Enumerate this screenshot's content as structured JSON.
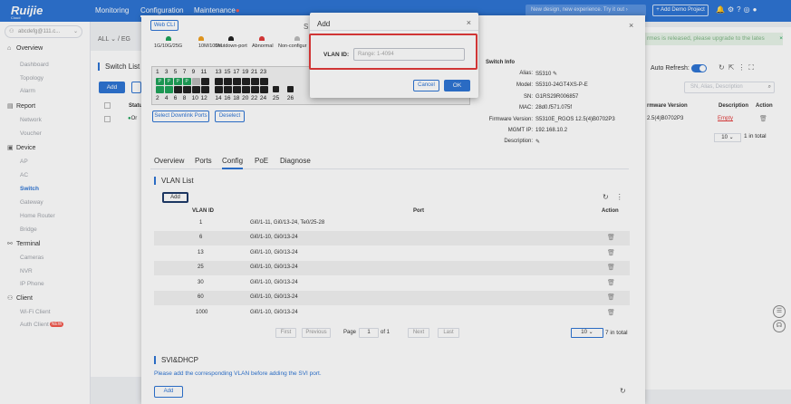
{
  "topbar": {
    "logo": "Ruijie",
    "logo_sub": "Cloud",
    "nav": [
      "Monitoring",
      "Configuration",
      "Maintenance"
    ],
    "new_design": "New design, new experience. Try it out",
    "demo_button": "+ Add Demo Project"
  },
  "sidebar": {
    "account": "abcdefg@111.c...",
    "items": [
      {
        "label": "Overview",
        "icon": "home-icon",
        "subs": [
          "Dashboard",
          "Topology",
          "Alarm"
        ]
      },
      {
        "label": "Report",
        "icon": "report-icon",
        "subs": [
          "Network",
          "Voucher"
        ]
      },
      {
        "label": "Device",
        "icon": "device-icon",
        "subs": [
          "AP",
          "AC",
          "Switch",
          "Gateway",
          "Home Router",
          "Bridge"
        ]
      },
      {
        "label": "Terminal",
        "icon": "terminal-icon",
        "subs": [
          "Cameras",
          "NVR",
          "IP Phone"
        ]
      },
      {
        "label": "Client",
        "icon": "client-icon",
        "subs": [
          "Wi-Fi Client",
          "Auth Client"
        ]
      }
    ],
    "active_sub": "Switch",
    "new_badge": "NEW"
  },
  "background": {
    "breadcrumb": "ALL",
    "breadcrumb_sep": "/",
    "breadcrumb_next": "EG",
    "switch_list": "Switch List",
    "add": "Add",
    "status": "Status",
    "online": "Or",
    "firmware_notice": "rmes is released, please upgrade to the lates",
    "auto_refresh": "Auto Refresh:",
    "search_placeholder": "SN, Alias, Description",
    "columns": [
      "rmware Version",
      "Description",
      "Action"
    ],
    "row": {
      "firmware": "2.5(4)B0702P3",
      "description": "Empty"
    },
    "page_size": "10",
    "total": "1 in total"
  },
  "drawer": {
    "webcli": "Web CLI",
    "title_partial": "S",
    "legend": [
      {
        "label": "1G/10G/25G",
        "color": "#1fa35a"
      },
      {
        "label": "10M/100M",
        "color": "#f0a020"
      },
      {
        "label": "Shutdown-port",
        "color": "#222222"
      },
      {
        "label": "Abnormal",
        "color": "#e23a3a"
      },
      {
        "label": "Non-configur",
        "color": "#bbbbbb"
      }
    ],
    "top_ports": [
      "1",
      "3",
      "5",
      "7",
      "9",
      "11",
      "13",
      "15",
      "17",
      "19",
      "21",
      "23"
    ],
    "bottom_ports": [
      "2",
      "4",
      "6",
      "8",
      "10",
      "12",
      "14",
      "16",
      "18",
      "20",
      "22",
      "24",
      "25",
      "26"
    ],
    "select_downlink": "Select Downlink Ports",
    "deselect": "Deselect",
    "switch_info": {
      "title": "Switch Info",
      "fields": [
        {
          "label": "Alias:",
          "value": "S5310"
        },
        {
          "label": "Model:",
          "value": "S5310-24GT4XS-P-E"
        },
        {
          "label": "SN:",
          "value": "G1RS29R006857"
        },
        {
          "label": "MAC:",
          "value": "28d0.f571.075f"
        },
        {
          "label": "Firmware Version:",
          "value": "S5310E_RGOS 12.5(4)B0702P3"
        },
        {
          "label": "MGMT IP:",
          "value": "192.168.10.2"
        },
        {
          "label": "Description:",
          "value": ""
        }
      ]
    },
    "tabs": [
      "Overview",
      "Ports",
      "Config",
      "PoE",
      "Diagnose"
    ],
    "active_tab": "Config",
    "vlan_list": {
      "title": "VLAN List",
      "add": "Add",
      "headers": [
        "VLAN ID",
        "Port",
        "Action"
      ],
      "rows": [
        {
          "id": "1",
          "port": "Gi0/1-11, Gi0/13-24, Te0/25-28"
        },
        {
          "id": "6",
          "port": "Gi0/1-10, Gi0/13-24"
        },
        {
          "id": "13",
          "port": "Gi0/1-10, Gi0/13-24"
        },
        {
          "id": "25",
          "port": "Gi0/1-10, Gi0/13-24"
        },
        {
          "id": "30",
          "port": "Gi0/1-10, Gi0/13-24"
        },
        {
          "id": "60",
          "port": "Gi0/1-10, Gi0/13-24"
        },
        {
          "id": "1000",
          "port": "Gi0/1-10, Gi0/13-24"
        }
      ],
      "pager": {
        "first": "First",
        "prev": "Previous",
        "page": "Page",
        "page_num": "1",
        "of": "of 1",
        "next": "Next",
        "last": "Last",
        "size": "10",
        "total": "7 in total"
      }
    },
    "svi": {
      "title": "SVI&DHCP",
      "hint": "Please add the corresponding VLAN before adding the SVI port.",
      "add": "Add"
    }
  },
  "dialog": {
    "title": "Add",
    "vlan_label": "VLAN ID:",
    "vlan_placeholder": "Range: 1-4094",
    "cancel": "Cancel",
    "ok": "OK"
  }
}
